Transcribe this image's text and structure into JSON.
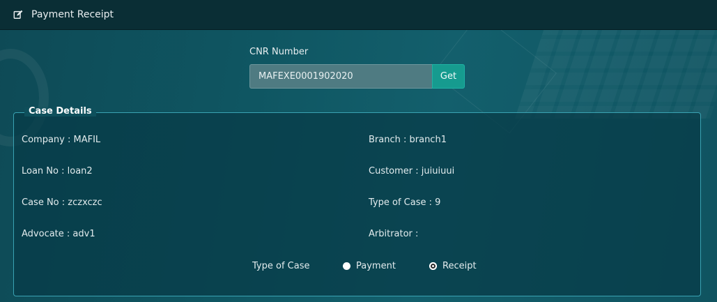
{
  "header": {
    "title": "Payment Receipt",
    "icon": "edit-icon"
  },
  "cnr": {
    "label": "CNR Number",
    "value": "MAFEXE0001902020",
    "button_label": "Get"
  },
  "case_details": {
    "legend": "Case Details",
    "company": "Company : MAFIL",
    "branch": "Branch : branch1",
    "loan_no": "Loan No : loan2",
    "customer": "Customer : juiuiuui",
    "case_no": "Case No : zczxczc",
    "type_of_case_value": "Type of Case : 9",
    "advocate": "Advocate : adv1",
    "arbitrator": "Arbitrator :"
  },
  "type_of_case": {
    "label": "Type of Case",
    "options": [
      "Payment",
      "Receipt"
    ],
    "selected": "Receipt"
  },
  "colors": {
    "topbar": "#0a2e35",
    "accent": "#169b8f",
    "border": "#3aa3b3"
  }
}
